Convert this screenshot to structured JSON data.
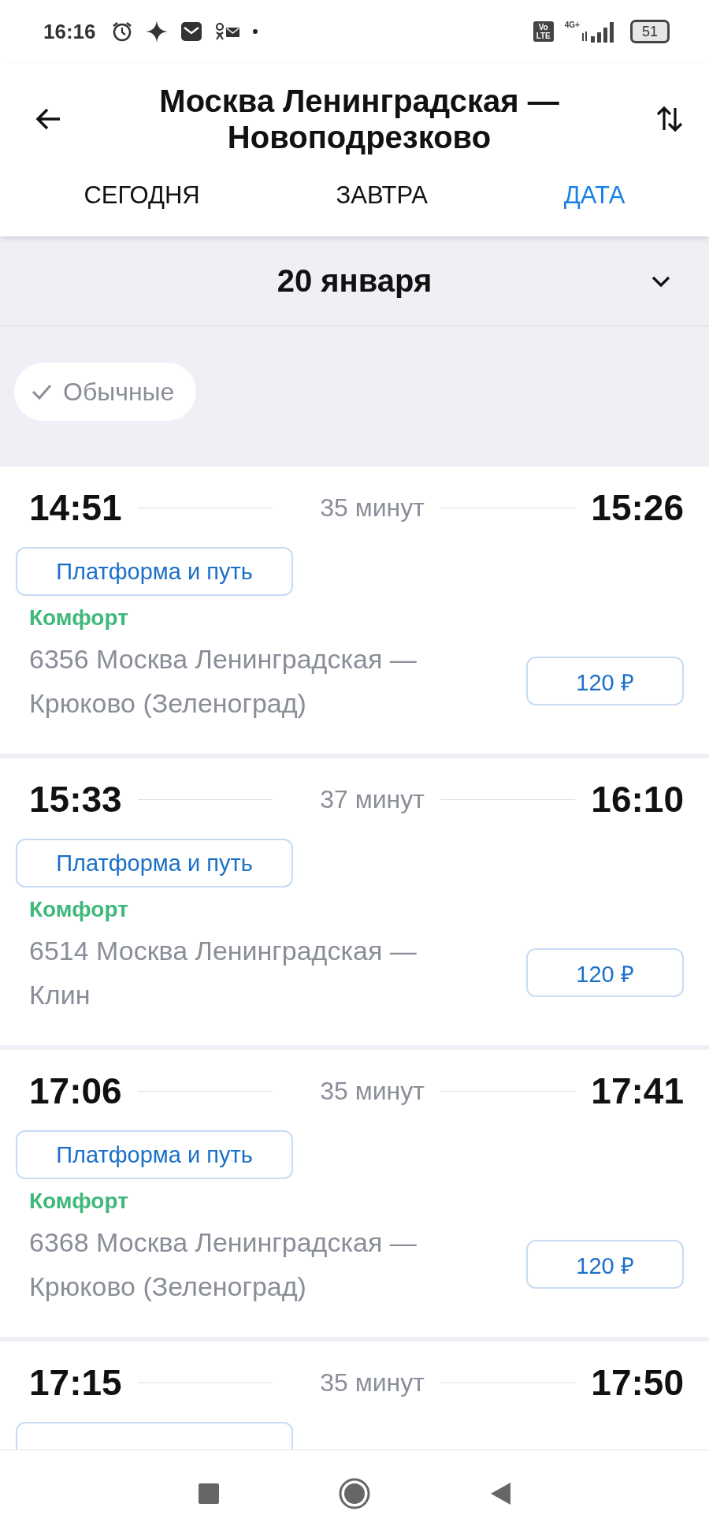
{
  "status_bar": {
    "time": "16:16",
    "volte": [
      "Vo",
      "LTE"
    ],
    "network": "4G+",
    "battery": "51"
  },
  "header": {
    "title": "Москва Ленинградская — Новоподрезково"
  },
  "tabs": [
    {
      "label": "СЕГОДНЯ",
      "selected": false
    },
    {
      "label": "ЗАВТРА",
      "selected": false
    },
    {
      "label": "ДАТА",
      "selected": true
    }
  ],
  "date": "20 января",
  "filters": [
    {
      "label": "Обычные",
      "checked": true
    }
  ],
  "trains": [
    {
      "departure": "14:51",
      "duration": "35 минут",
      "arrival": "15:26",
      "platform_button": "Платформа и путь",
      "train_class": "Комфорт",
      "route": "6356 Москва Ленинградская — Крюково (Зеленоград)",
      "price": "120 ₽"
    },
    {
      "departure": "15:33",
      "duration": "37 минут",
      "arrival": "16:10",
      "platform_button": "Платформа и путь",
      "train_class": "Комфорт",
      "route": "6514 Москва Ленинградская — Клин",
      "price": "120 ₽"
    },
    {
      "departure": "17:06",
      "duration": "35 минут",
      "arrival": "17:41",
      "platform_button": "Платформа и путь",
      "train_class": "Комфорт",
      "route": "6368 Москва Ленинградская — Крюково (Зеленоград)",
      "price": "120 ₽"
    },
    {
      "departure": "17:15",
      "duration": "35 минут",
      "arrival": "17:50"
    }
  ]
}
